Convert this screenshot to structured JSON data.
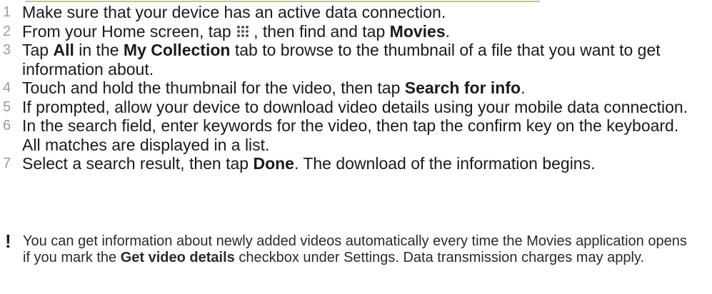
{
  "steps": [
    {
      "num": "1",
      "t0": "Make sure that your device has an active data connection."
    },
    {
      "num": "2",
      "t0": "From your Home screen, tap ",
      "icon": "app-grid-icon",
      "t1": ", then find and tap ",
      "b1": "Movies",
      "t2": "."
    },
    {
      "num": "3",
      "t0": "Tap ",
      "b1": "All",
      "t1": " in the ",
      "b2": "My Collection",
      "t2": " tab to browse to the thumbnail of a file that you want to get information about."
    },
    {
      "num": "4",
      "t0": "Touch and hold the thumbnail for the video, then tap ",
      "b1": "Search for info",
      "t1": "."
    },
    {
      "num": "5",
      "t0": "If prompted, allow your device to download video details using your mobile data connection."
    },
    {
      "num": "6",
      "t0": "In the search field, enter keywords for the video, then tap the confirm key on the keyboard. All matches are displayed in a list."
    },
    {
      "num": "7",
      "t0": "Select a search result, then tap ",
      "b1": "Done",
      "t1": ". The download of the information begins."
    }
  ],
  "note": {
    "icon_glyph": "!",
    "icon": "exclamation-icon",
    "t0": "You can get information about newly added videos automatically every time the Movies application opens if you mark the ",
    "b1": "Get video details",
    "t1": " checkbox under Settings. Data transmission charges may apply."
  },
  "colors": {
    "text": "#1a1a1a",
    "step_number": "#9a9a9a",
    "accent": "#a6c83a"
  }
}
